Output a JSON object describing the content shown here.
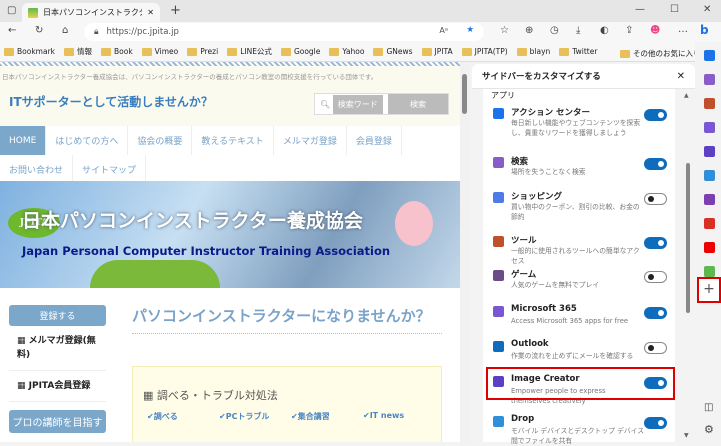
{
  "browser": {
    "tab_title": "日本パソコンインストラクター養成協会",
    "url": "https://pc.jpita.jp",
    "bookmarks": [
      "Bookmark",
      "情報",
      "Book",
      "Vimeo",
      "Prezi",
      "LINE公式",
      "Google",
      "Yahoo",
      "GNews",
      "JPITA",
      "JPITA(TP)",
      "blayn",
      "Twitter"
    ],
    "other_bookmarks": "その他のお気に入り"
  },
  "page": {
    "tagline": "日本パソコンインストラクター養成協会は、パソコンインストラクターの養成とパソコン教室の開校支援を行っている団体です。",
    "catch": "ITサポーターとして活動しませんか？",
    "search_placeholder": "検索ワード",
    "search_button": "検索",
    "nav": [
      "HOME",
      "はじめての方へ",
      "協会の概要",
      "教えるテキスト",
      "メルマガ登録",
      "会員登録",
      "お問い合わせ",
      "サイトマップ"
    ],
    "banner_title": "日本パソコンインストラクター養成協会",
    "banner_subtitle": "Japan Personal Computer Instructor Training Association",
    "logo": "JPITA",
    "register_button": "登録する",
    "left_items": [
      "メルマガ登録(無料)",
      "JPITA会員登録"
    ],
    "pro_button": "プロの講師を目指す",
    "heading": "パソコンインストラクターになりませんか？",
    "box_title": "調べる・トラブル対処法",
    "box_links": [
      "調べる",
      "PCトラブル",
      "集合講習",
      "IT news"
    ]
  },
  "sidebar": {
    "title": "サイドバーをカスタマイズする",
    "section": "アプリ",
    "apps": [
      {
        "name": "アクション センター",
        "desc": "毎日新しい機能やウェブコンテンツを探索し、貴重なリワードを獲得しましょう",
        "on": true,
        "color": "#1a73e8"
      },
      {
        "name": "検索",
        "desc": "場所を失うことなく検索",
        "on": true,
        "color": "#8a5cc9"
      },
      {
        "name": "ショッピング",
        "desc": "買い物中のクーポン、割引の比較、お金の節約",
        "on": false,
        "color": "#4f7be8"
      },
      {
        "name": "ツール",
        "desc": "一般的に使用されるツールへの簡単なアクセス",
        "on": true,
        "color": "#c0502c"
      },
      {
        "name": "ゲーム",
        "desc": "人気のゲームを無料でプレイ",
        "on": false,
        "color": "#6b4c8a"
      },
      {
        "name": "Microsoft 365",
        "desc": "Access Microsoft 365 apps for free",
        "on": true,
        "color": "#7a55d4"
      },
      {
        "name": "Outlook",
        "desc": "作業の流れを止めずにメールを確認する",
        "on": false,
        "color": "#0f6cbd"
      },
      {
        "name": "Image Creator",
        "desc": "Empower people to express themselves creatively",
        "on": true,
        "color": "#5b3fc4"
      },
      {
        "name": "Drop",
        "desc": "モバイル デバイスとデスクトップ デバイス間でファイルを共有",
        "on": true,
        "color": "#2f8fd8"
      }
    ]
  }
}
